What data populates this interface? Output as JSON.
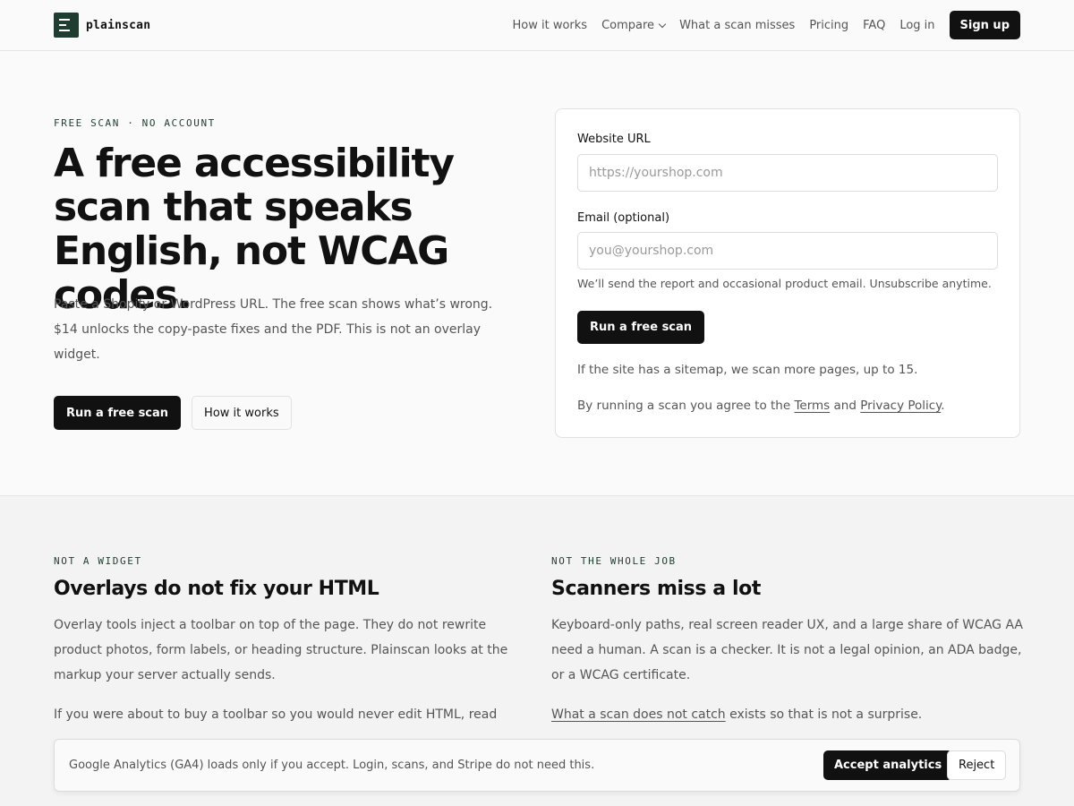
{
  "brand": {
    "name": "plainscan"
  },
  "nav": {
    "items": [
      "How it works",
      "Compare",
      "What a scan misses",
      "Pricing",
      "FAQ",
      "Log in"
    ],
    "signup_label": "Sign up"
  },
  "hero": {
    "eyebrow": "FREE SCAN · NO ACCOUNT",
    "title": "A free accessibility scan that speaks English, not WCAG codes.",
    "body": "Paste a Shopify or WordPress URL. The free scan shows what’s wrong. $14 unlocks the copy-paste fixes and the PDF. This is not an overlay widget.",
    "primary_cta": "Run a free scan",
    "secondary_cta": "How it works"
  },
  "scan_form": {
    "url_label": "Website URL",
    "url_placeholder": "https://yourshop.com",
    "url_value": "",
    "email_label": "Email (optional)",
    "email_placeholder": "you@yourshop.com",
    "email_value": "",
    "email_hint": "We’ll send the report and occasional product email. Unsubscribe anytime.",
    "submit_label": "Run a free scan",
    "sitemap_note": "If the site has a sitemap, we scan more pages, up to 15.",
    "terms_prefix": "By running a scan you agree to the ",
    "terms_link": "Terms",
    "terms_and": " and ",
    "privacy_link": "Privacy Policy",
    "terms_suffix": "."
  },
  "sections": [
    {
      "eyebrow": "NOT A WIDGET",
      "title": "Overlays do not fix your HTML",
      "body": "Overlay tools inject a toolbar on top of the page. They do not rewrite product photos, form labels, or heading structure. Plainscan looks at the markup your server actually sends.",
      "body2": "If you were about to buy a toolbar so you would never edit HTML, read"
    },
    {
      "eyebrow": "NOT THE WHOLE JOB",
      "title": "Scanners miss a lot",
      "body": "Keyboard-only paths, real screen reader UX, and a large share of WCAG AA need a human. A scan is a checker. It is not a legal opinion, an ADA badge, or a WCAG certificate.",
      "link": "What a scan does not catch",
      "link_suffix": " exists so that is not a surprise."
    }
  ],
  "cookie_banner": {
    "text": "Google Analytics (GA4) loads only if you accept. Login, scans, and Stripe do not need this.",
    "accept_label": "Accept analytics",
    "reject_label": "Reject"
  },
  "colors": {
    "brand_green": "#1f3d30",
    "button_dark": "#111111",
    "muted_text": "#555555"
  }
}
